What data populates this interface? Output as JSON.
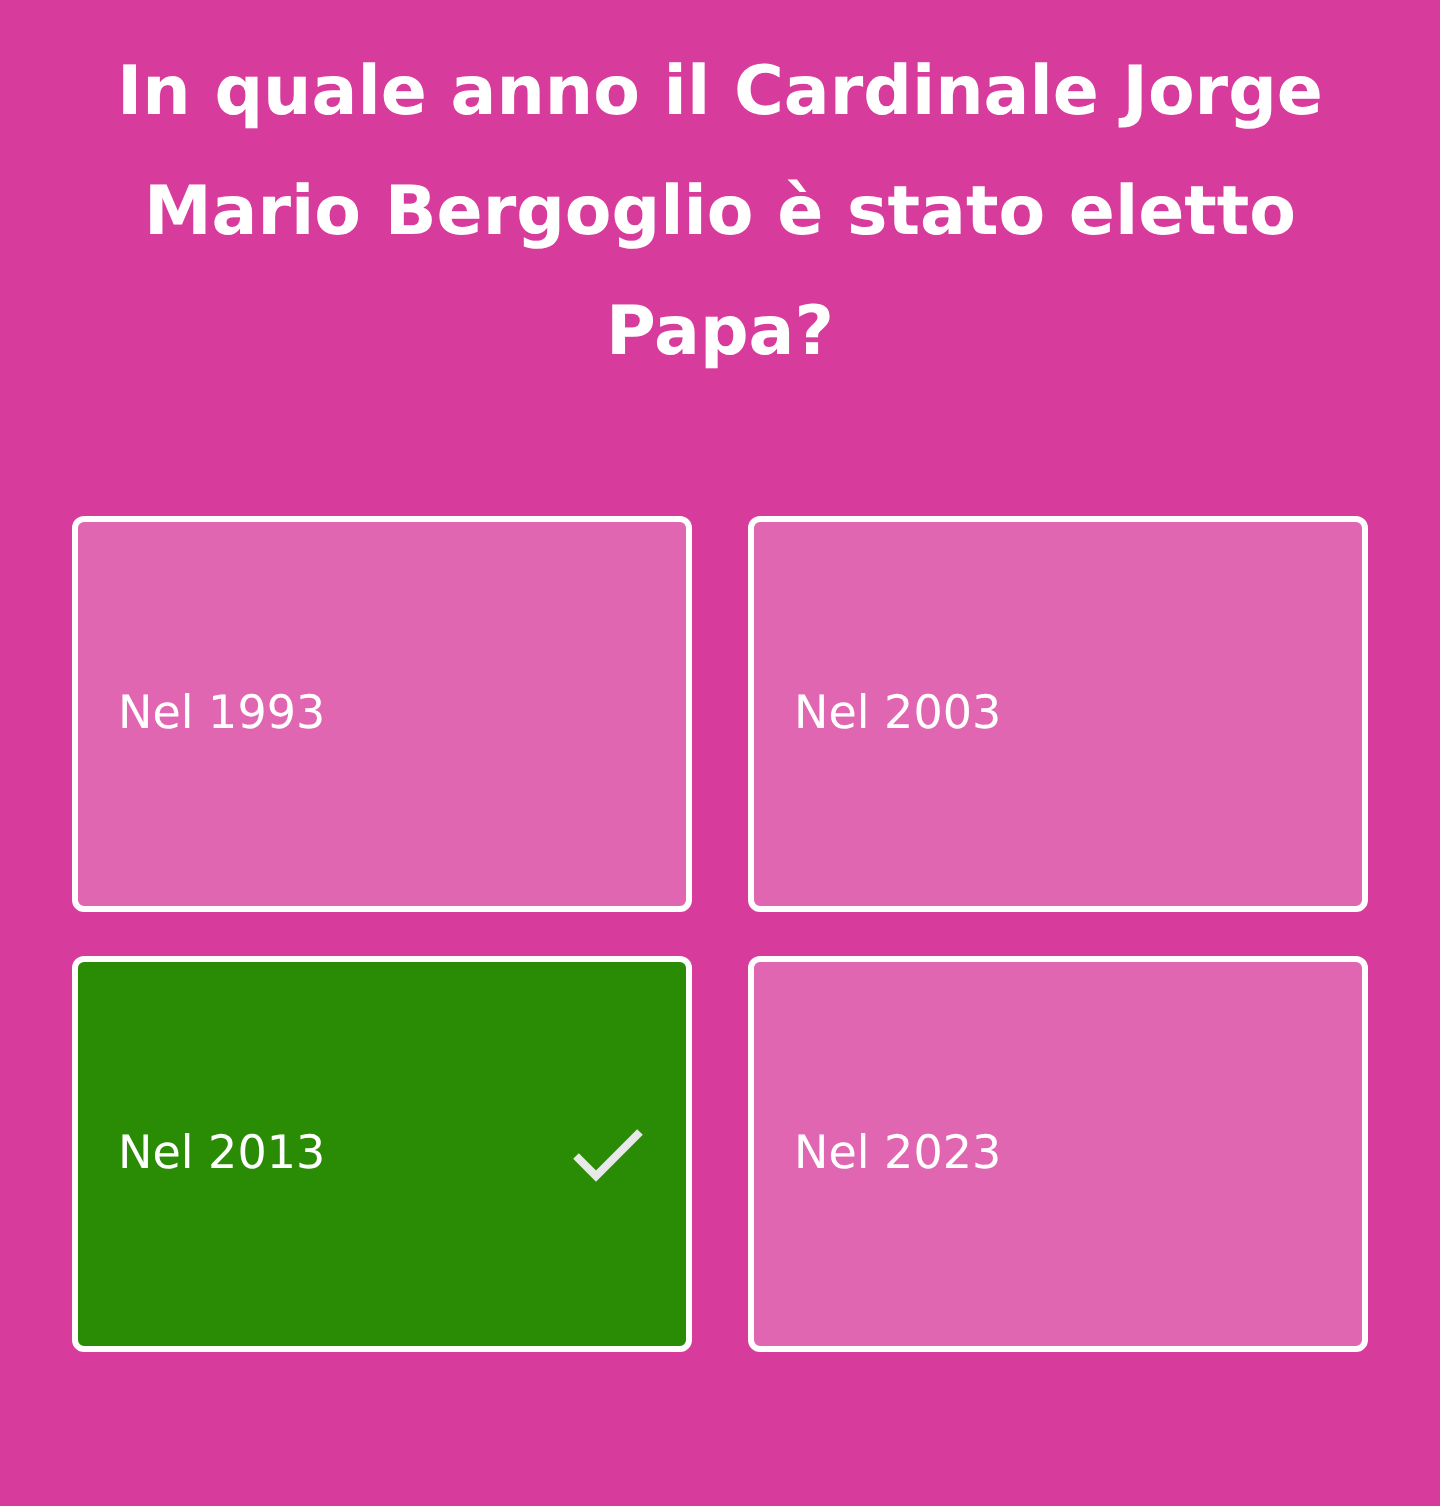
{
  "question": "In quale anno il Cardinale Jorge Mario Bergoglio è stato eletto Papa?",
  "answers": [
    {
      "label": "Nel 1993",
      "correct": false
    },
    {
      "label": "Nel 2003",
      "correct": false
    },
    {
      "label": "Nel 2013",
      "correct": true
    },
    {
      "label": "Nel 2023",
      "correct": false
    }
  ]
}
